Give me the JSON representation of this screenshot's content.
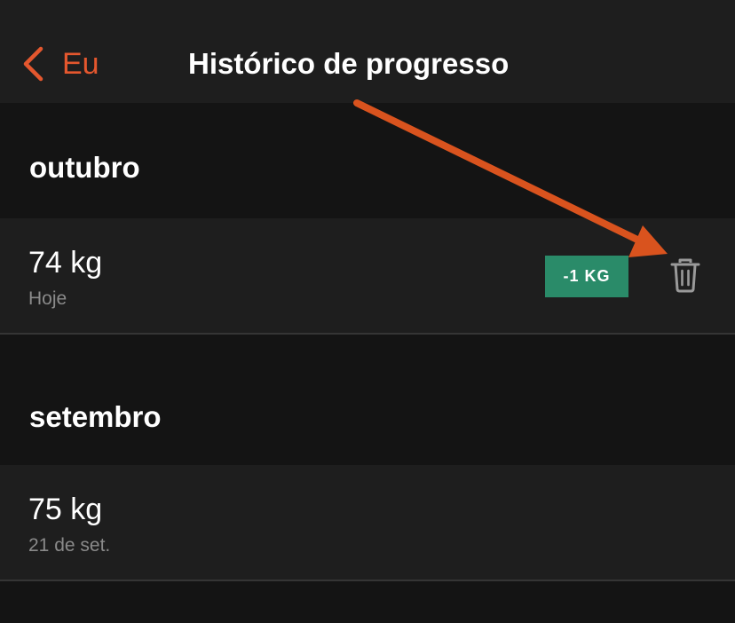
{
  "navbar": {
    "back_label": "Eu",
    "title": "Histórico de progresso"
  },
  "sections": [
    {
      "title": "outubro",
      "entries": [
        {
          "value": "74 kg",
          "date": "Hoje",
          "change": "-1 KG",
          "change_color": "#2a8b69"
        }
      ]
    },
    {
      "title": "setembro",
      "entries": [
        {
          "value": "75 kg",
          "date": "21 de set."
        }
      ]
    }
  ],
  "colors": {
    "accent": "#e4572e",
    "background": "#141414",
    "row_background": "#1e1e1e",
    "annotation_arrow": "#d9531e"
  },
  "icons": {
    "back": "chevron-left-icon",
    "delete": "trash-icon"
  }
}
